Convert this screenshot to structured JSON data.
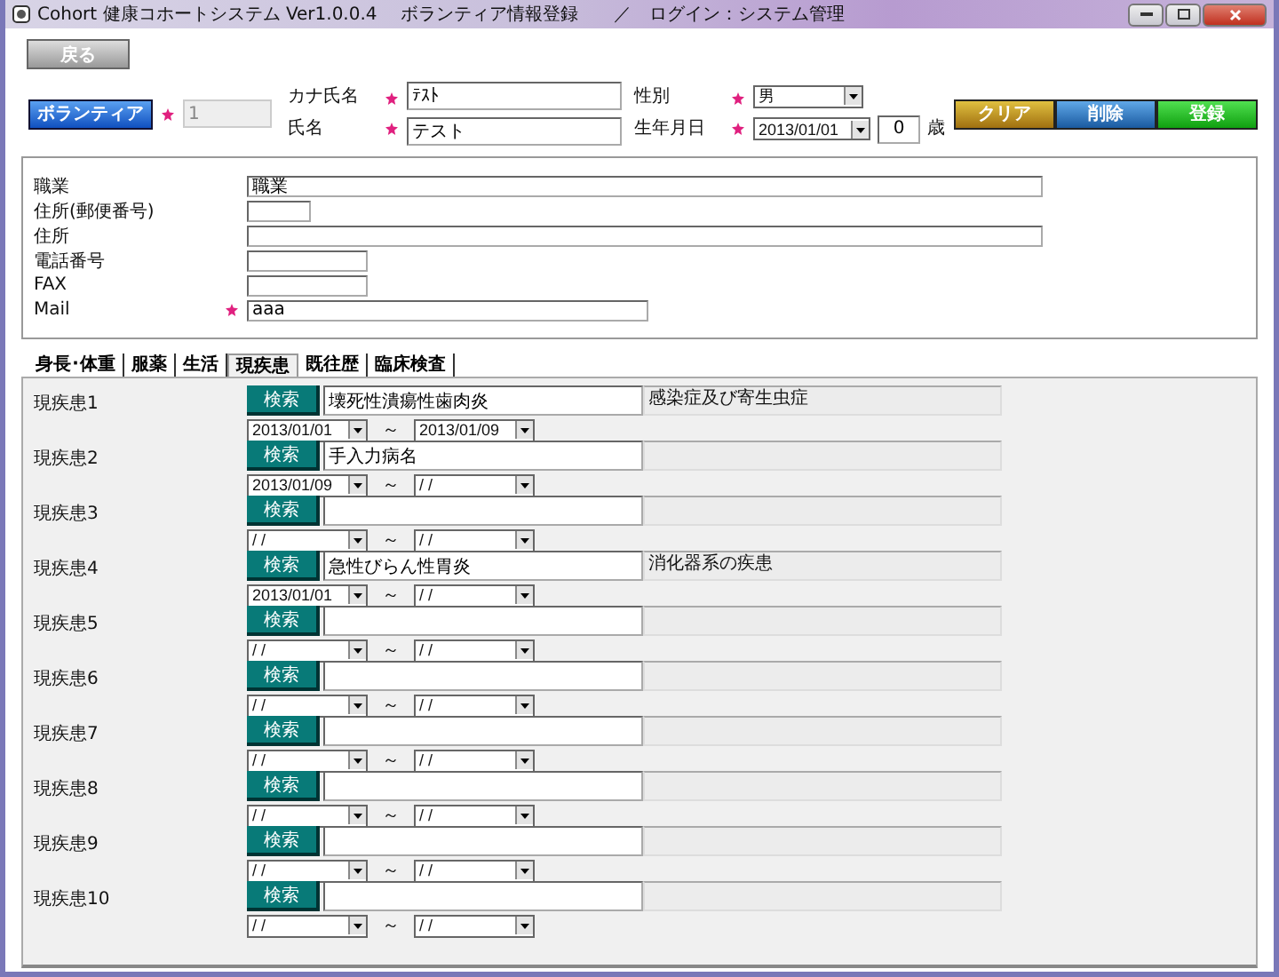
{
  "window": {
    "title": "Cohort 健康コホートシステム Ver1.0.0.4　 ボランティア情報登録　　／　ログイン：システム管理"
  },
  "back_button": "戻る",
  "header": {
    "volunteer_button": "ボランティア",
    "id_value": "1",
    "kana_label": "カナ氏名",
    "kana_value": "ﾃｽﾄ",
    "name_label": "氏名",
    "name_value": "テスト",
    "sex_label": "性別",
    "sex_value": "男",
    "birth_label": "生年月日",
    "birth_value": "2013/01/01",
    "age_value": "0",
    "age_unit": "歳"
  },
  "actions": [
    {
      "label": "クリア",
      "kind": "clear"
    },
    {
      "label": "削除",
      "kind": "delete"
    },
    {
      "label": "登録",
      "kind": "register"
    }
  ],
  "info_fields": [
    {
      "label": "職業",
      "value": "職業",
      "required": false
    },
    {
      "label": "住所(郵便番号)",
      "required": false
    },
    {
      "label": "住所",
      "required": false
    },
    {
      "label": "電話番号",
      "required": false
    },
    {
      "label": "FAX",
      "required": false
    },
    {
      "label": "Mail",
      "value": "aaa",
      "required": true
    }
  ],
  "tabs": [
    {
      "label": "身長･体重",
      "selected": false
    },
    {
      "label": "服薬",
      "selected": false
    },
    {
      "label": "生活",
      "selected": false
    },
    {
      "label": "現疾患",
      "selected": true
    },
    {
      "label": "既往歴",
      "selected": false
    },
    {
      "label": "臨床検査",
      "selected": false
    }
  ],
  "tilde": "～",
  "diseases": [
    {
      "label": "現疾患1",
      "search": "検索",
      "name": "壊死性潰瘍性歯肉炎",
      "category": "感染症及び寄生虫症",
      "start": "2013/01/01",
      "end": "2013/01/09"
    },
    {
      "label": "現疾患2",
      "search": "検索",
      "name": "手入力病名",
      "start": "2013/01/09",
      "end": "/ /"
    },
    {
      "label": "現疾患3",
      "search": "検索",
      "start": "/ /",
      "end": "/ /"
    },
    {
      "label": "現疾患4",
      "search": "検索",
      "name": "急性びらん性胃炎",
      "category": "消化器系の疾患",
      "start": "2013/01/01",
      "end": "/ /"
    },
    {
      "label": "現疾患5",
      "search": "検索",
      "start": "/ /",
      "end": "/ /"
    },
    {
      "label": "現疾患6",
      "search": "検索",
      "start": "/ /",
      "end": "/ /"
    },
    {
      "label": "現疾患7",
      "search": "検索",
      "start": "/ /",
      "end": "/ /"
    },
    {
      "label": "現疾患8",
      "search": "検索",
      "start": "/ /",
      "end": "/ /"
    },
    {
      "label": "現疾患9",
      "search": "検索",
      "start": "/ /",
      "end": "/ /"
    },
    {
      "label": "現疾患10",
      "search": "検索",
      "start": "/ /",
      "end": "/ /"
    }
  ]
}
